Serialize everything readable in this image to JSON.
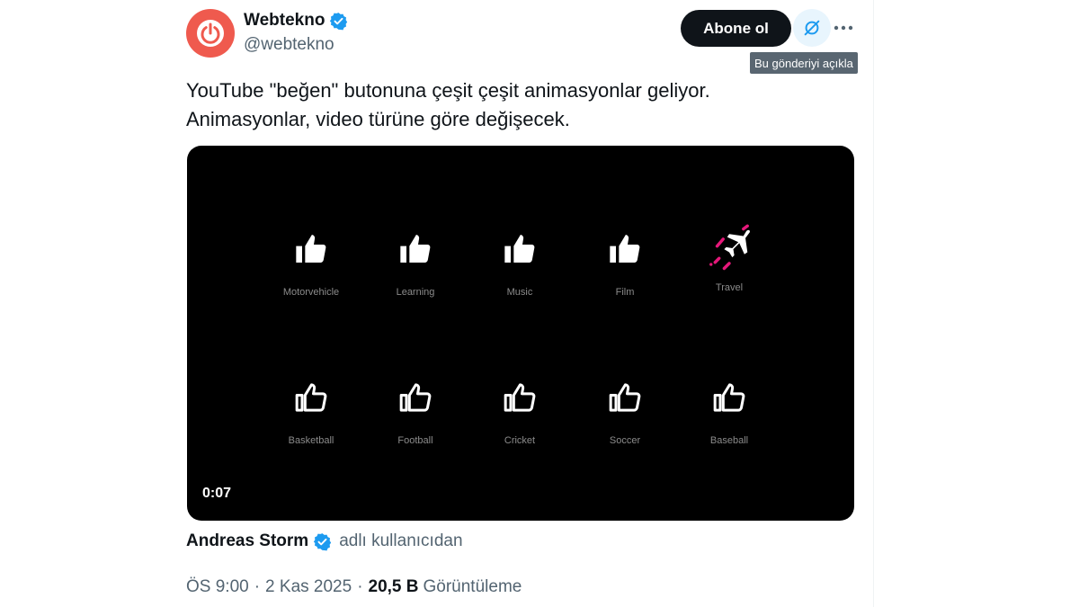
{
  "author": {
    "display_name": "Webtekno",
    "handle": "@webtekno",
    "avatar_icon": "power-logo-icon",
    "avatar_color": "#ef5a4e",
    "verified_icon": "verified-badge-icon"
  },
  "actions": {
    "subscribe_label": "Abone ol",
    "grok_icon": "grok-icon",
    "explain_tooltip": "Bu gönderiyi açıkla",
    "more_icon": "more-dots-icon"
  },
  "tweet": {
    "line1": "YouTube \"beğen\" butonuna çeşit çeşit animasyonlar geliyor.",
    "line2": "Animasyonlar, video türüne göre değişecek."
  },
  "media": {
    "timestamp": "0:07",
    "top_row": [
      {
        "label": "Motorvehicle",
        "icon": "thumbs-up-filled-icon"
      },
      {
        "label": "Learning",
        "icon": "thumbs-up-filled-icon"
      },
      {
        "label": "Music",
        "icon": "thumbs-up-filled-icon"
      },
      {
        "label": "Film",
        "icon": "thumbs-up-filled-icon"
      },
      {
        "label": "Travel",
        "icon": "airplane-icon"
      }
    ],
    "bottom_row": [
      {
        "label": "Basketball",
        "icon": "thumbs-up-outline-icon"
      },
      {
        "label": "Football",
        "icon": "thumbs-up-outline-icon"
      },
      {
        "label": "Cricket",
        "icon": "thumbs-up-outline-icon"
      },
      {
        "label": "Soccer",
        "icon": "thumbs-up-outline-icon"
      },
      {
        "label": "Baseball",
        "icon": "thumbs-up-outline-icon"
      }
    ]
  },
  "credit": {
    "name": "Andreas Storm",
    "suffix": "adlı kullanıcıdan"
  },
  "meta": {
    "time": "ÖS 9:00",
    "separator": "·",
    "date": "2 Kas 2025",
    "views": "20,5 B",
    "views_label": "Görüntüleme"
  },
  "colors": {
    "verified": "#1d9bf0",
    "secondary_text": "#536471",
    "primary_text": "#0f1419",
    "travel_accent": "#e6187a"
  }
}
